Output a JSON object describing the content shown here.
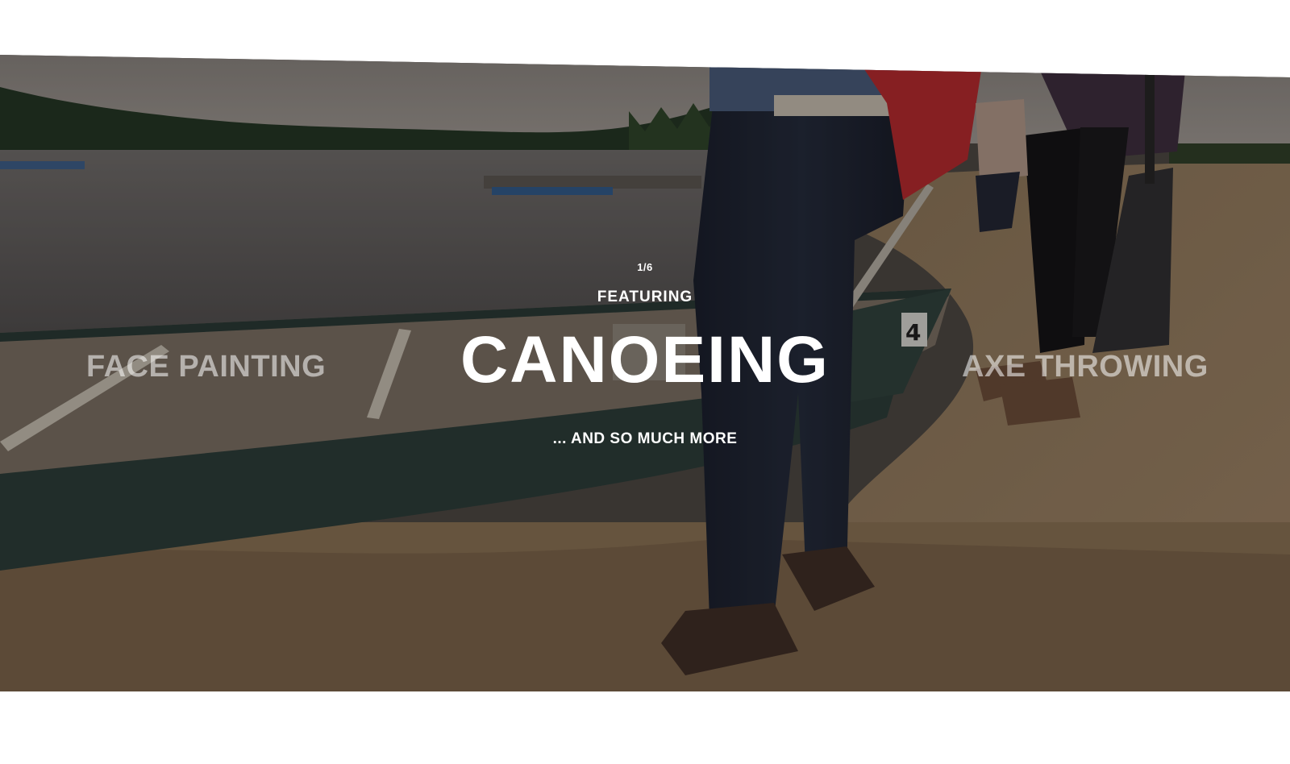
{
  "slider": {
    "counter": "1/6",
    "kicker": "FEATURING",
    "current": "CANOEING",
    "previous": "FACE PAINTING",
    "next": "AXE THROWING",
    "footer": "... AND SO MUCH MORE"
  }
}
